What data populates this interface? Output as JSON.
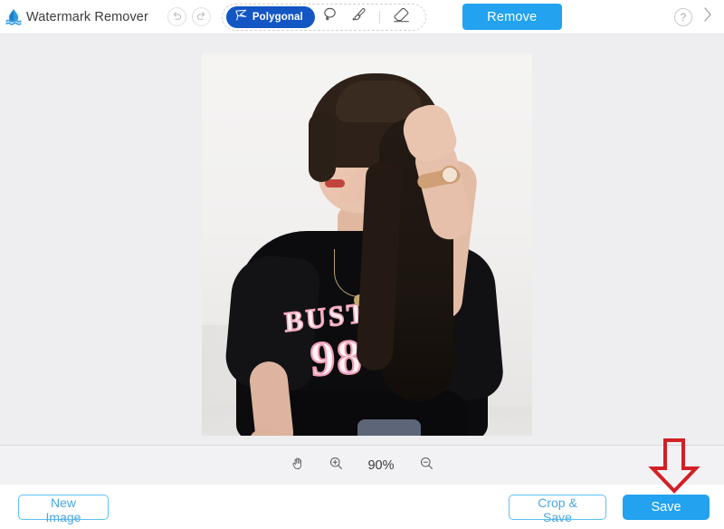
{
  "app": {
    "brand_title": "Watermark Remover",
    "logo_icon": "water-drop-icon",
    "accent_blue": "#22a2ef",
    "tool_active_blue": "#1356c4",
    "annotation_red": "#d31f26"
  },
  "header": {
    "undo_icon": "undo-arrow-icon",
    "redo_icon": "redo-arrow-icon",
    "tools": [
      {
        "id": "polygonal",
        "label": "Polygonal",
        "icon": "polygonal-lasso-icon",
        "active": true
      },
      {
        "id": "lasso",
        "label": "",
        "icon": "free-lasso-icon",
        "active": false
      },
      {
        "id": "brush",
        "label": "",
        "icon": "brush-icon",
        "active": false
      },
      {
        "id": "eraser",
        "label": "",
        "icon": "eraser-icon",
        "active": false
      }
    ],
    "remove_label": "Remove",
    "help_label": "?",
    "help_icon": "question-mark-icon",
    "collapse_icon": "chevron-right-icon"
  },
  "canvas": {
    "photo_alt": "Young woman in black BUSTA 98 t-shirt holding her hair",
    "shirt_text": "BUSTA",
    "shirt_number": "98"
  },
  "zoombar": {
    "pan_icon": "hand-pan-icon",
    "zoom_in_icon": "zoom-in-icon",
    "zoom_out_icon": "zoom-out-icon",
    "zoom_level": "90%"
  },
  "footer": {
    "new_image_label": "New Image",
    "crop_save_label": "Crop & Save",
    "save_label": "Save"
  },
  "annotation": {
    "arrow_icon": "red-down-arrow-icon",
    "points_at": "save-button"
  }
}
